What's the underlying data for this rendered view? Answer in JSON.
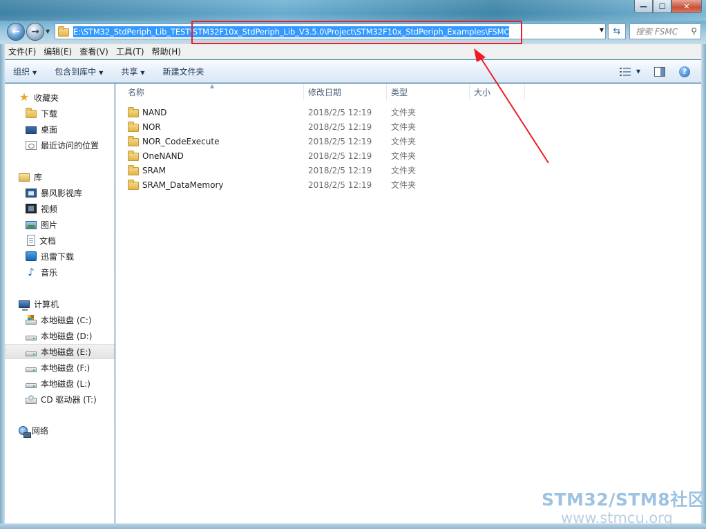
{
  "window": {
    "controls": {
      "minimize": "—",
      "maximize": "☐",
      "close": "✕"
    }
  },
  "address_bar": {
    "path": "E:\\STM32_StdPeriph_Lib_TEST\\STM32F10x_StdPeriph_Lib_V3.5.0\\Project\\STM32F10x_StdPeriph_Examples\\FSMC",
    "search_placeholder": "搜索 FSMC"
  },
  "menu": [
    "文件(F)",
    "编辑(E)",
    "查看(V)",
    "工具(T)",
    "帮助(H)"
  ],
  "toolbar": {
    "organize": "组织",
    "include_in_library": "包含到库中",
    "share": "共享",
    "new_folder": "新建文件夹"
  },
  "sidebar": {
    "favorites": {
      "title": "收藏夹",
      "items": [
        "下载",
        "桌面",
        "最近访问的位置"
      ]
    },
    "libraries": {
      "title": "库",
      "items": [
        "暴风影视库",
        "视频",
        "图片",
        "文档",
        "迅雷下载",
        "音乐"
      ]
    },
    "computer": {
      "title": "计算机",
      "items": [
        "本地磁盘 (C:)",
        "本地磁盘 (D:)",
        "本地磁盘 (E:)",
        "本地磁盘 (F:)",
        "本地磁盘 (L:)",
        "CD 驱动器 (T:)"
      ],
      "selected": "本地磁盘 (E:)"
    },
    "network": {
      "title": "网络"
    }
  },
  "columns": {
    "name": "名称",
    "modified": "修改日期",
    "type": "类型",
    "size": "大小"
  },
  "files": [
    {
      "name": "NAND",
      "modified": "2018/2/5 12:19",
      "type": "文件夹"
    },
    {
      "name": "NOR",
      "modified": "2018/2/5 12:19",
      "type": "文件夹"
    },
    {
      "name": "NOR_CodeExecute",
      "modified": "2018/2/5 12:19",
      "type": "文件夹"
    },
    {
      "name": "OneNAND",
      "modified": "2018/2/5 12:19",
      "type": "文件夹"
    },
    {
      "name": "SRAM",
      "modified": "2018/2/5 12:19",
      "type": "文件夹"
    },
    {
      "name": "SRAM_DataMemory",
      "modified": "2018/2/5 12:19",
      "type": "文件夹"
    }
  ],
  "watermark": {
    "line1": "STM32/STM8社区",
    "line2": "www.stmcu.org"
  },
  "colors": {
    "annotation": "#ee1c24",
    "selection": "#3399ff"
  }
}
